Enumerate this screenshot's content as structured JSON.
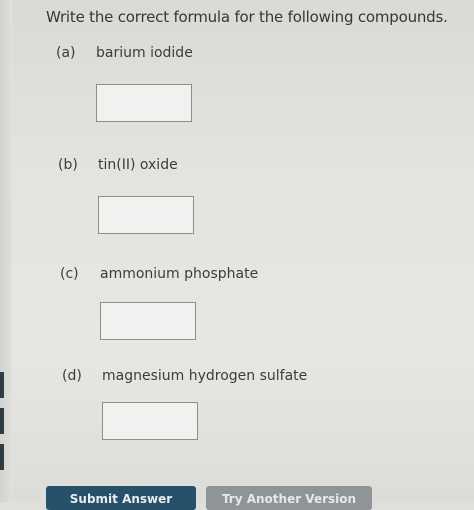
{
  "instruction": "Write the correct formula for the following compounds.",
  "questions": [
    {
      "letter": "(a)",
      "compound": "barium iodide",
      "answer": ""
    },
    {
      "letter": "(b)",
      "compound": "tin(II) oxide",
      "answer": ""
    },
    {
      "letter": "(c)",
      "compound": "ammonium phosphate",
      "answer": ""
    },
    {
      "letter": "(d)",
      "compound": "magnesium hydrogen sulfate",
      "answer": ""
    }
  ],
  "buttons": {
    "submit_label": "Submit Answer",
    "another_label": "Try Another Version"
  }
}
